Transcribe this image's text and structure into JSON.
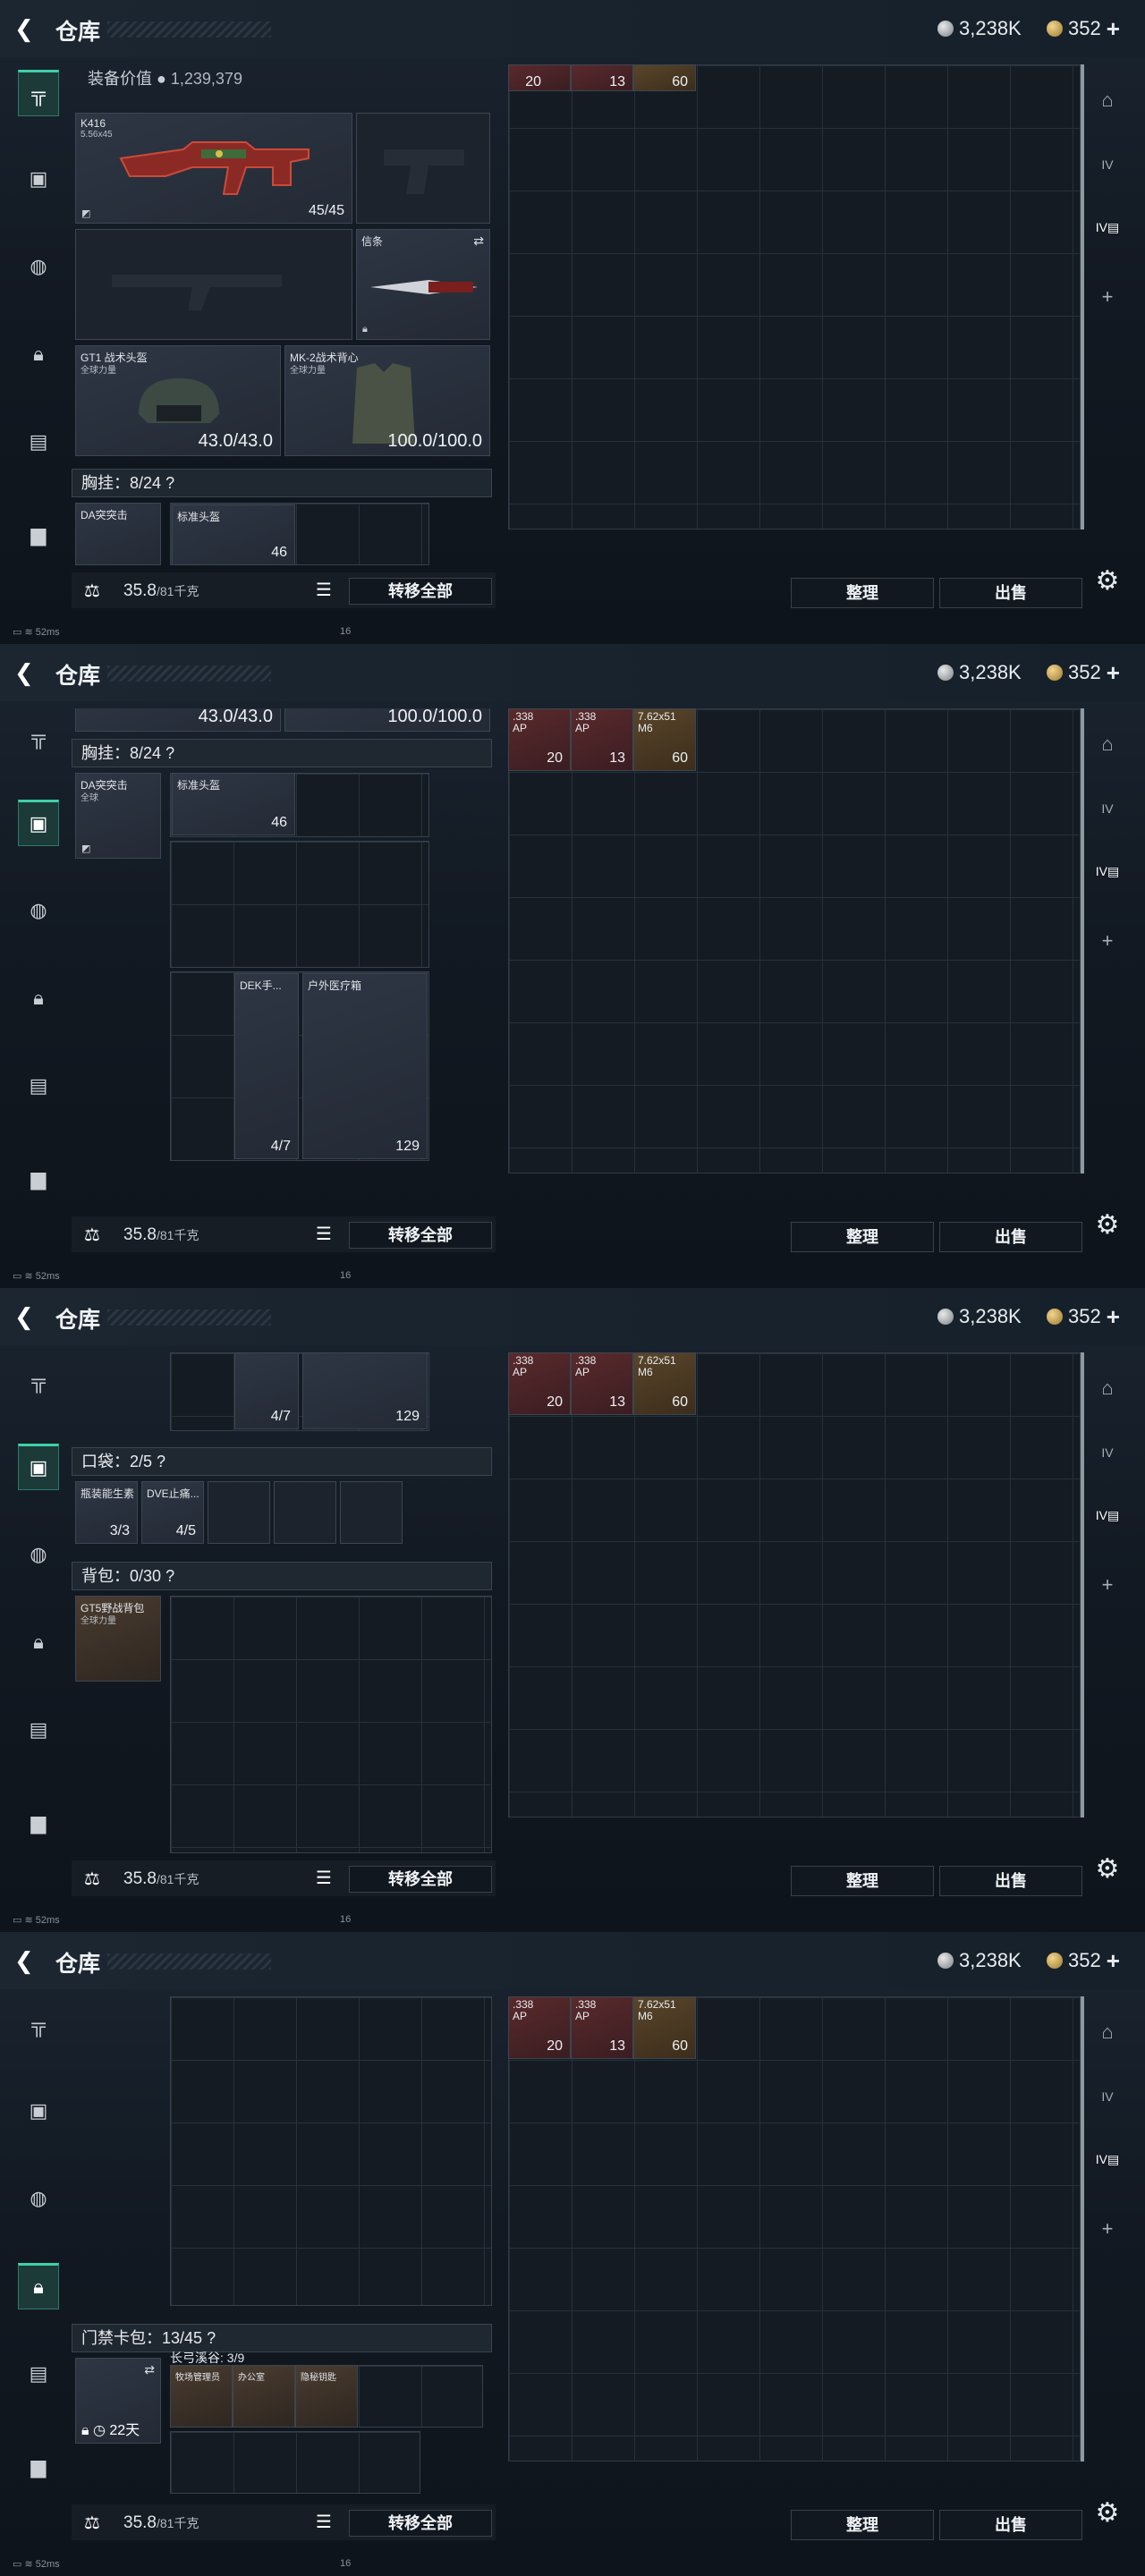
{
  "header": {
    "back_icon": "back-arrow-icon",
    "title": "仓库",
    "currency1": "3,238K",
    "currency2": "352"
  },
  "panels": [
    {
      "loadout_value_label": "装备价值",
      "loadout_value": "1,239,379",
      "primary": {
        "name": "K416",
        "caliber": "5.56x45",
        "ammo": "45/45"
      },
      "melee": {
        "slot_label": "信条"
      },
      "helmet": {
        "name": "GT1 战术头盔",
        "tag": "全球力量",
        "durability": "43.0/43.0"
      },
      "vest": {
        "name": "MK-2战术背心",
        "tag": "全球力量",
        "durability": "100.0/100.0"
      },
      "chest_label": "胸挂：8/24",
      "rig_name": "DA突突击",
      "headset_name": "标准头盔",
      "headset_count": "46",
      "sidebar_active": 0
    },
    {
      "helmet_dur": "43.0/43.0",
      "vest_dur": "100.0/100.0",
      "chest_label": "胸挂：8/24",
      "rig_name": "DA突突击",
      "rig_tag": "全球",
      "headset_name": "标准头盔",
      "headset_count": "46",
      "item1_name": "DEK手...",
      "item1_count": "4/7",
      "item2_name": "户外医疗箱",
      "item2_count": "129",
      "sidebar_active": 1
    },
    {
      "item1_count": "4/7",
      "item2_count": "129",
      "pocket_label": "口袋：2/5",
      "pocket1_name": "瓶装能生素",
      "pocket1_count": "3/3",
      "pocket2_name": "DVE止痛...",
      "pocket2_count": "4/5",
      "backpack_label": "背包：0/30",
      "backpack_name": "GT5野战背包",
      "backpack_tag": "全球力量",
      "sidebar_active": 1
    },
    {
      "keycard_label": "门禁卡包：13/45",
      "map_label": "长弓溪谷: 3/9",
      "card1": "牧场管理员",
      "card2": "办公室",
      "card3": "隐秘钥匙",
      "timer": "22天",
      "sidebar_active": 3
    }
  ],
  "ammo": [
    {
      "label": ".338",
      "type": "AP",
      "count": "20"
    },
    {
      "label": ".338",
      "type": "AP",
      "count": "13"
    },
    {
      "label": "7.62x51",
      "type": "M6",
      "count": "60"
    }
  ],
  "bottom": {
    "weight": "35.8",
    "weight_max": "/81千克",
    "transfer_all": "转移全部",
    "sort": "整理",
    "sell": "出售"
  },
  "status": {
    "ping": "52ms",
    "num": "16"
  },
  "icons": {
    "sidebar": [
      "gun-icon",
      "armor-icon",
      "backpack-icon",
      "lock-icon",
      "card-icon",
      "briefcase-icon"
    ],
    "right": [
      "safe-icon",
      "level-iv-icon",
      "level-iv-stack-icon",
      "plus-icon"
    ]
  }
}
